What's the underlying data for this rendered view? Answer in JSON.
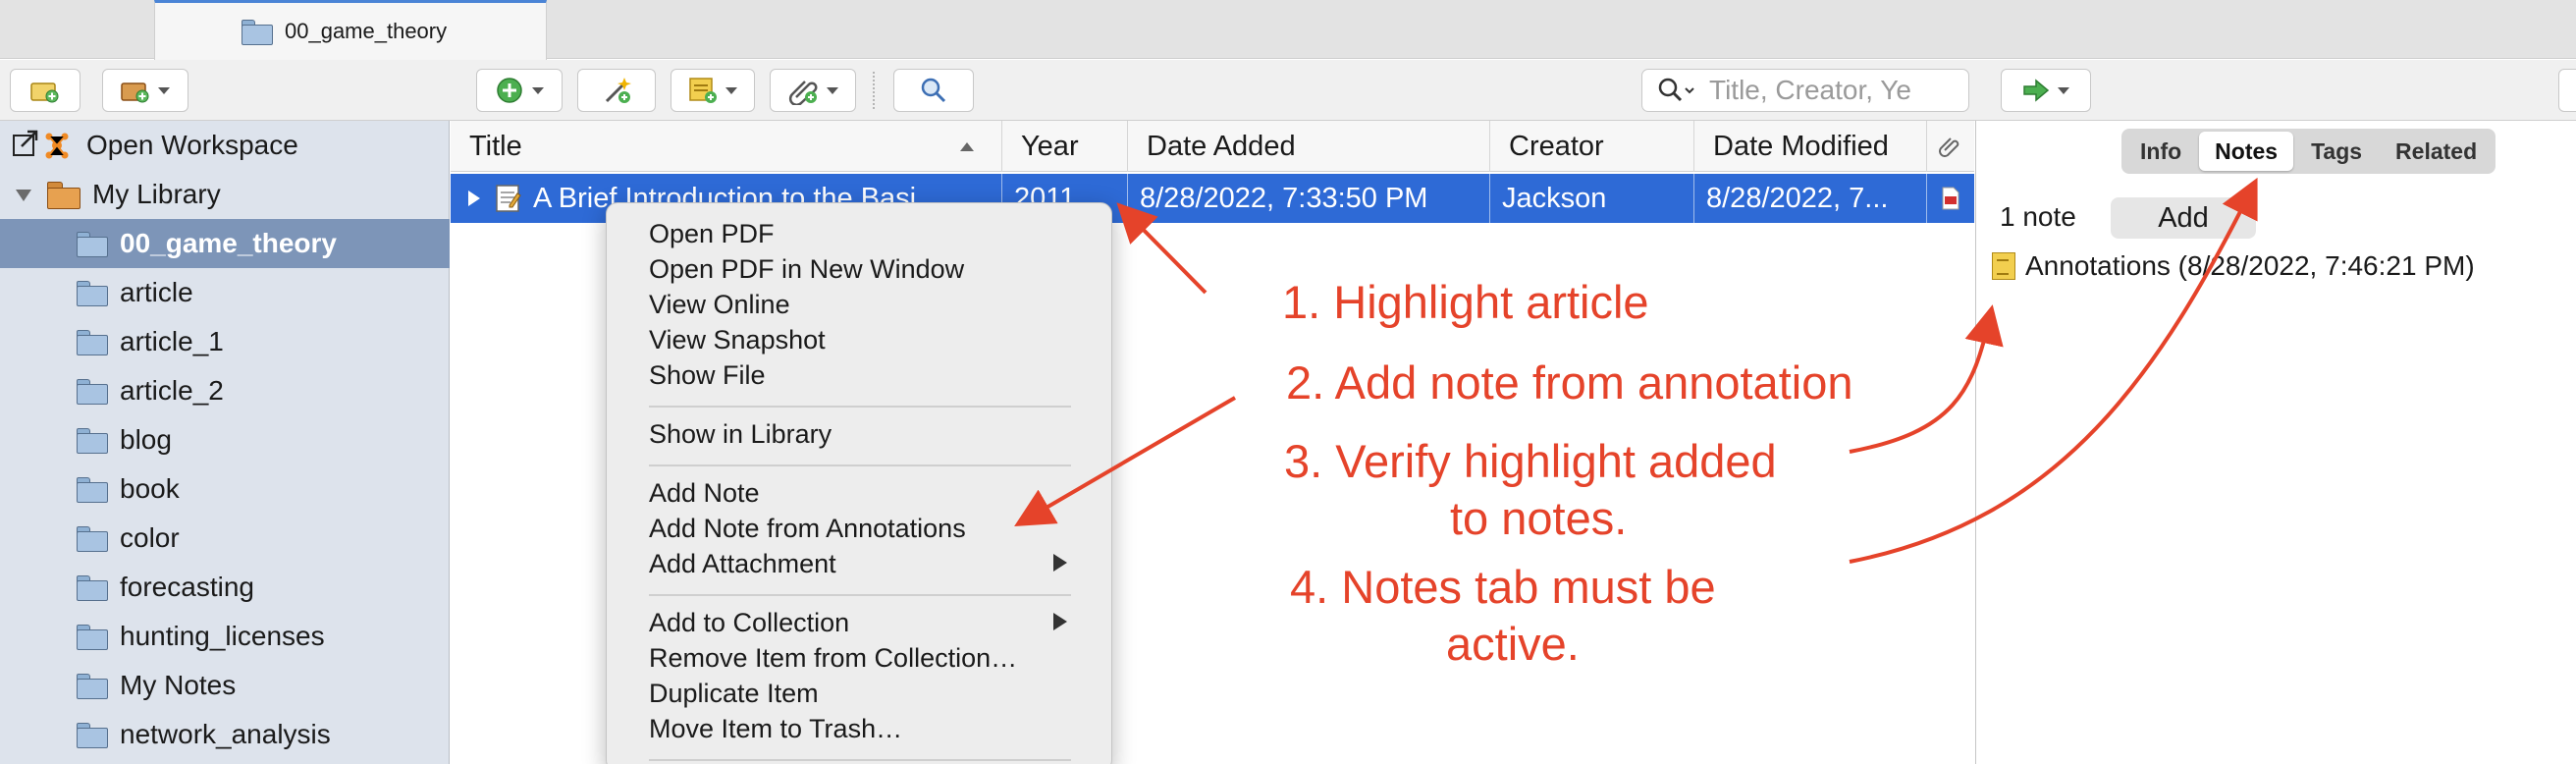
{
  "tabs": [
    {
      "label": "00_game_theory",
      "icon": "folder-icon"
    }
  ],
  "toolbar": {
    "search_placeholder": "Title, Creator, Ye",
    "buttons": [
      "new-collection",
      "new-library",
      "new-item",
      "add-by-identifier",
      "new-note",
      "add-attachment",
      "advanced-search",
      "locate"
    ]
  },
  "sidebar": {
    "workspace_label": "Open Workspace",
    "library_label": "My Library",
    "collections": [
      "00_game_theory",
      "article",
      "article_1",
      "article_2",
      "blog",
      "book",
      "color",
      "forecasting",
      "hunting_licenses",
      "My Notes",
      "network_analysis"
    ],
    "selected": "00_game_theory"
  },
  "items": {
    "columns": [
      "Title",
      "Year",
      "Date Added",
      "Creator",
      "Date Modified"
    ],
    "sorted_by": "Title",
    "rows": [
      {
        "title": "A Brief Introduction to the Basi",
        "year": "2011",
        "date_added": "8/28/2022, 7:33:50 PM",
        "creator": "Jackson",
        "date_modified": "8/28/2022, 7...",
        "selected": true
      }
    ]
  },
  "right_pane": {
    "tabs": [
      "Info",
      "Notes",
      "Tags",
      "Related"
    ],
    "active_tab": "Notes",
    "note_count": "1 note",
    "add_label": "Add",
    "notes": [
      "Annotations (8/28/2022, 7:46:21 PM)"
    ]
  },
  "context_menu": {
    "items": [
      "Open PDF",
      "Open PDF in New Window",
      "View Online",
      "View Snapshot",
      "Show File",
      "Show in Library",
      "Add Note",
      "Add Note from Annotations",
      "Add Attachment",
      "Add to Collection",
      "Remove Item from Collection…",
      "Duplicate Item",
      "Move Item to Trash…"
    ]
  },
  "annotations": {
    "step1": "1. Highlight article",
    "step2": "2. Add note from annotation",
    "step3_line1": "3. Verify highlight added",
    "step3_line2": "to notes.",
    "step4_line1": "4. Notes tab must be",
    "step4_line2": "active.",
    "color": "#e5432a"
  },
  "colors": {
    "selection": "#2e6ad6",
    "sidebar": "#dde3ec",
    "sidebar_selected": "#7d95b8"
  }
}
